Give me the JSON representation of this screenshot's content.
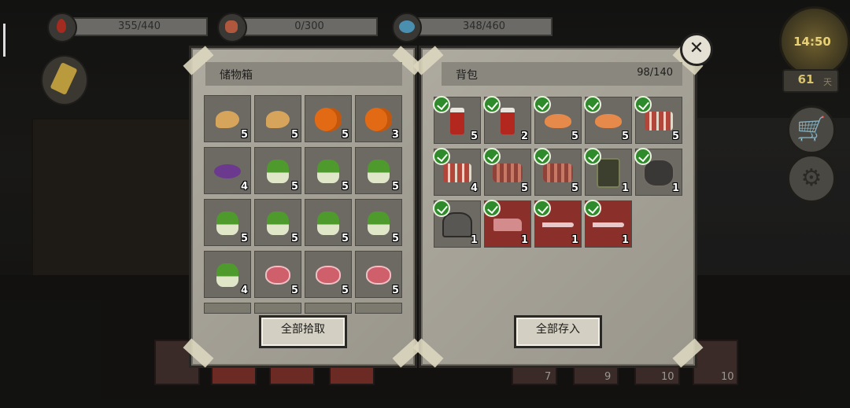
{
  "status": {
    "health": "355/440",
    "hunger": "0/300",
    "mind": "348/460"
  },
  "clock": {
    "time": "14:50",
    "days": "61",
    "days_unit": "天"
  },
  "storage": {
    "title": "储物箱",
    "button": "全部拾取",
    "slots": [
      {
        "item": "drumstick",
        "qty": "5"
      },
      {
        "item": "drumstick",
        "qty": "5"
      },
      {
        "item": "pumpkin",
        "qty": "5"
      },
      {
        "item": "pumpkin",
        "qty": "3"
      },
      {
        "item": "eggplant",
        "qty": "4"
      },
      {
        "item": "bokchoy",
        "qty": "5"
      },
      {
        "item": "bokchoy",
        "qty": "5"
      },
      {
        "item": "bokchoy",
        "qty": "5"
      },
      {
        "item": "bokchoy",
        "qty": "5"
      },
      {
        "item": "bokchoy",
        "qty": "5"
      },
      {
        "item": "bokchoy",
        "qty": "5"
      },
      {
        "item": "bokchoy",
        "qty": "5"
      },
      {
        "item": "bokchoy",
        "qty": "4"
      },
      {
        "item": "meat",
        "qty": "5"
      },
      {
        "item": "meat",
        "qty": "5"
      },
      {
        "item": "meat",
        "qty": "5"
      }
    ]
  },
  "bag": {
    "title": "背包",
    "count": "98/140",
    "button": "全部存入",
    "slots": [
      {
        "item": "bottle",
        "qty": "5",
        "red": false
      },
      {
        "item": "bottle",
        "qty": "2",
        "red": false
      },
      {
        "item": "croissant",
        "qty": "5",
        "red": false
      },
      {
        "item": "croissant",
        "qty": "5",
        "red": false
      },
      {
        "item": "kebab",
        "qty": "5",
        "red": false
      },
      {
        "item": "kebab",
        "qty": "4",
        "red": false
      },
      {
        "item": "ribs",
        "qty": "5",
        "red": false
      },
      {
        "item": "ribs",
        "qty": "5",
        "red": false
      },
      {
        "item": "armor",
        "qty": "1",
        "red": false
      },
      {
        "item": "rock",
        "qty": "1",
        "red": false
      },
      {
        "item": "helmet",
        "qty": "1",
        "red": false
      },
      {
        "item": "gun",
        "qty": "1",
        "red": true
      },
      {
        "item": "blade",
        "qty": "1",
        "red": true
      },
      {
        "item": "blade",
        "qty": "1",
        "red": true
      }
    ]
  },
  "hotbar_counts": [
    "7",
    "9",
    "10",
    "10"
  ]
}
